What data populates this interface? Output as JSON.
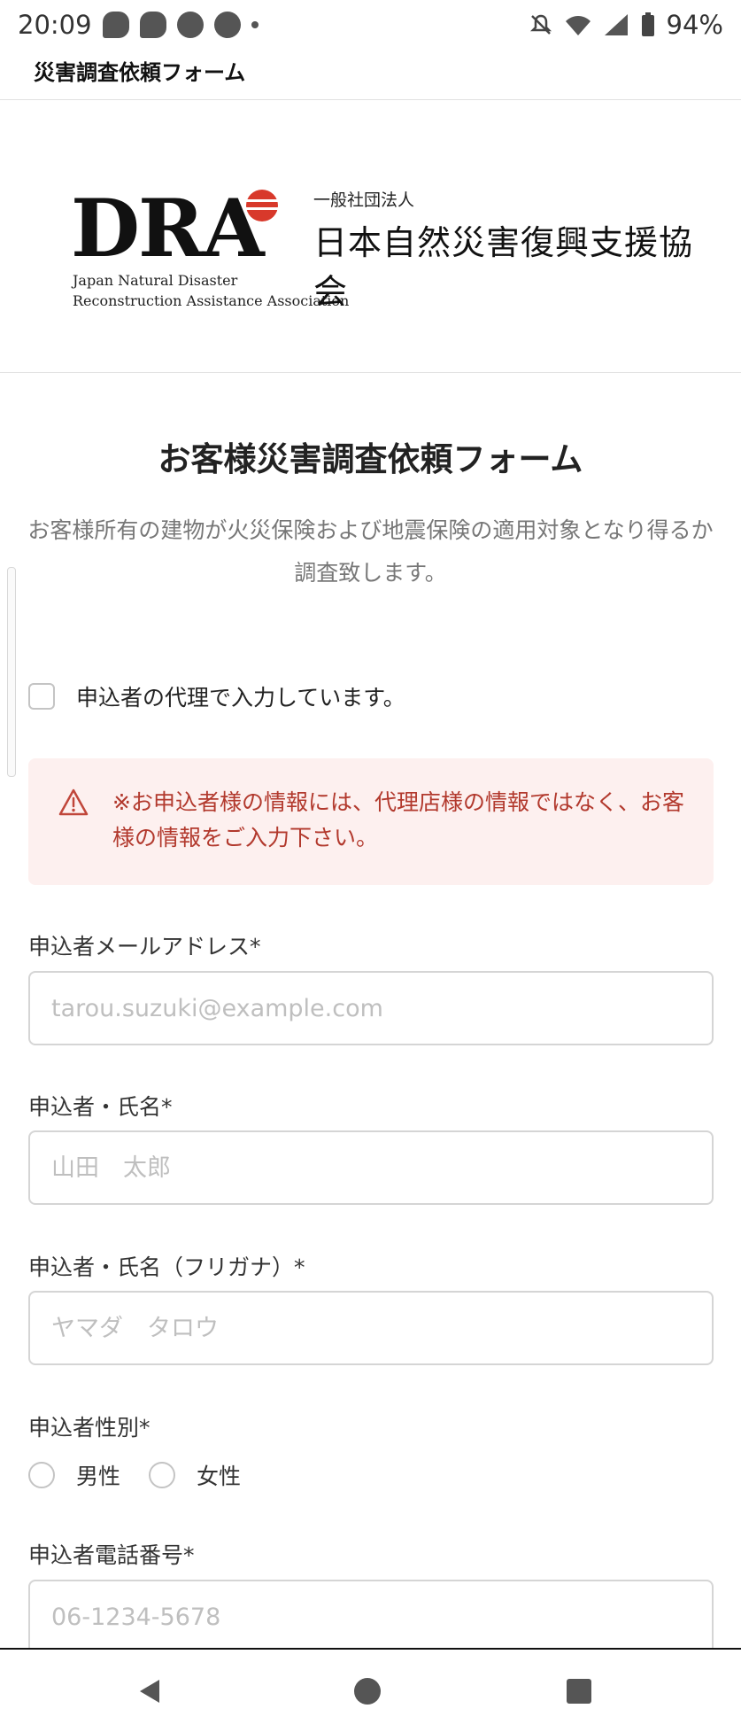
{
  "status_bar": {
    "time": "20:09",
    "notification_icons": [
      "line-icon",
      "chat-plus-icon",
      "facebook-icon",
      "facebook-icon",
      "dot-icon"
    ],
    "status_icons": [
      "mute-icon",
      "wifi-icon",
      "signal-icon",
      "battery-icon"
    ],
    "battery": "94%"
  },
  "app_bar": {
    "title": "災害調査依頼フォーム"
  },
  "logo": {
    "abbr": "DRA",
    "en_line1": "Japan Natural Disaster",
    "en_line2": "Reconstruction Assistance Association",
    "org_type": "一般社団法人",
    "org_name": "日本自然災害復興支援協会",
    "mark_color": "#d8392b"
  },
  "form": {
    "title": "お客様災害調査依頼フォーム",
    "description": "お客様所有の建物が火災保険および地震保険の適用対象となり得るか調査致します。",
    "proxy_checkbox": {
      "label": "申込者の代理で入力しています。",
      "checked": false
    },
    "alert": {
      "text": "※お申込者様の情報には、代理店様の情報ではなく、お客様の情報をご入力下さい。",
      "color": "#b2392d",
      "background": "#fdf0ef"
    },
    "fields": {
      "email": {
        "label": "申込者メールアドレス*",
        "placeholder": "tarou.suzuki@example.com",
        "value": ""
      },
      "name": {
        "label": "申込者・氏名*",
        "placeholder": "山田　太郎",
        "value": ""
      },
      "name_kana": {
        "label": "申込者・氏名（フリガナ）*",
        "placeholder": "ヤマダ　タロウ",
        "value": ""
      },
      "gender": {
        "label": "申込者性別*",
        "options": [
          "男性",
          "女性"
        ],
        "selected": null
      },
      "phone": {
        "label": "申込者電話番号*",
        "placeholder": "06-1234-5678",
        "value": ""
      }
    }
  },
  "nav_bar": {
    "buttons": [
      "back-icon",
      "home-icon",
      "recents-icon"
    ]
  }
}
